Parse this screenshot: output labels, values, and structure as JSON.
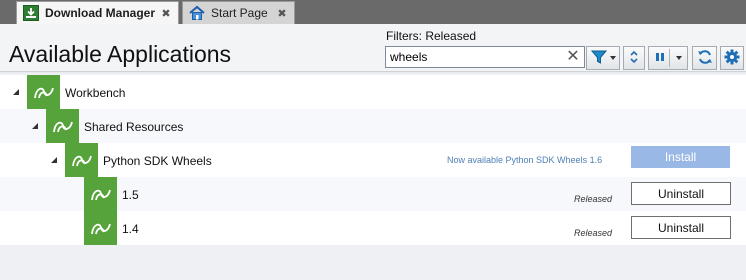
{
  "tabs": [
    {
      "label": "Download Manager",
      "close": "✖",
      "icon": "download-icon",
      "active": true
    },
    {
      "label": "Start Page",
      "close": "✖",
      "icon": "home-icon",
      "active": false
    }
  ],
  "header": {
    "title": "Available Applications",
    "filters_label": "Filters: Released",
    "search": {
      "value": "wheels",
      "clear_glyph": "✕"
    }
  },
  "toolbar": {
    "filter_icon": "funnel-icon",
    "collapse_icon": "collapse-expand-icon",
    "pause_icon": "pause-icon",
    "refresh_icon": "refresh-icon",
    "settings_icon": "gear-icon"
  },
  "tree": {
    "workbench": {
      "label": "Workbench"
    },
    "shared_resources": {
      "label": "Shared Resources"
    },
    "python_sdk_wheels": {
      "label": "Python SDK Wheels",
      "available_text": "Now available Python SDK Wheels 1.6",
      "install_label": "Install"
    },
    "v15": {
      "label": "1.5",
      "status": "Released",
      "uninstall_label": "Uninstall"
    },
    "v14": {
      "label": "1.4",
      "status": "Released",
      "uninstall_label": "Uninstall"
    }
  },
  "colors": {
    "app_icon_green": "#55a33a",
    "install_button": "#9ab8e6",
    "available_text": "#4f7fb5",
    "tabstrip": "#6a6a6a"
  }
}
